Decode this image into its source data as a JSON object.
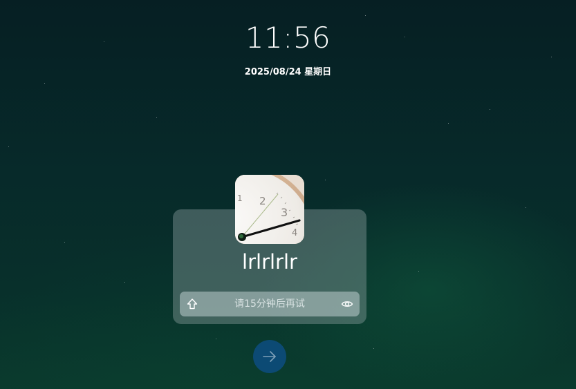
{
  "lock_screen": {
    "time": "11:56",
    "date": "2025/08/24 星期日"
  },
  "user": {
    "name": "lrlrlrlr",
    "avatar_icon": "clock-face-avatar"
  },
  "password_field": {
    "value": "",
    "placeholder": "请15分钟后再试",
    "left_icon": "caps-lock-shift-icon",
    "right_icon": "eye-icon"
  },
  "submit": {
    "icon": "arrow-right-icon"
  },
  "colors": {
    "background_top": "#061f23",
    "background_bottom": "#0a3a2d",
    "submit_button": "#0c4a74",
    "text": "#ffffff"
  }
}
